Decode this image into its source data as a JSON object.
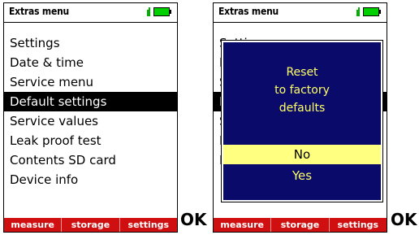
{
  "left_screen": {
    "title": "Extras menu",
    "menu_items": [
      "Settings",
      "Date & time",
      "Service menu",
      "Default settings",
      "Service values",
      "Leak proof test",
      "Contents SD card",
      "Device info"
    ],
    "selected_item": "Default settings",
    "softkeys": [
      "measure",
      "storage",
      "settings"
    ],
    "ok_label": "OK"
  },
  "right_screen": {
    "title": "Extras menu",
    "menu_items": [
      "Setti",
      "D",
      "S",
      "D",
      "S",
      "L",
      "D"
    ],
    "dialog": {
      "message_lines": [
        "Reset",
        "to factory",
        "defaults"
      ],
      "options": [
        "No",
        "Yes"
      ],
      "selected_option": "No"
    },
    "softkeys": [
      "measure",
      "storage",
      "settings"
    ],
    "ok_label": "OK"
  },
  "colors": {
    "softkey_bar": "#d01010",
    "dialog_background": "#0a0a6a",
    "dialog_text": "#ffff66",
    "dialog_selection": "#ffff80",
    "battery": "#00d000"
  },
  "icons": {
    "battery": "battery-icon",
    "power": "plug-icon"
  }
}
